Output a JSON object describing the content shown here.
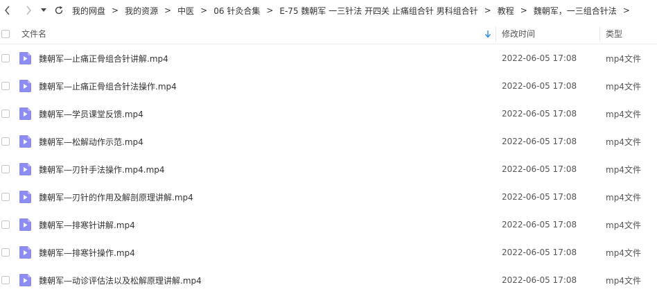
{
  "breadcrumb": {
    "separator": ">",
    "items": [
      "我的网盘",
      "我的资源",
      "中医",
      "06 针灸合集",
      "E-75 魏朝军 一三针法 开四关 止痛组合针 男科组合针",
      "教程",
      "魏朝军，一三组合针法"
    ],
    "trailing_separator": ">"
  },
  "header": {
    "name_label": "文件名",
    "modified_label": "修改时间",
    "type_label": "类型"
  },
  "icons": {
    "back": "chevron-left-icon",
    "forward": "chevron-right-icon",
    "dropdown": "caret-down-icon",
    "refresh": "refresh-icon",
    "sort": "sort-down-icon",
    "file": "video-file-icon"
  },
  "colors": {
    "sort_arrow": "#2b8ce8",
    "file_icon": "#8c8cf3"
  },
  "files": [
    {
      "name": "魏朝军—止痛正骨组合针讲解.mp4",
      "modified": "2022-06-05 17:08",
      "type": "mp4文件"
    },
    {
      "name": "魏朝军—止痛正骨组合针法操作.mp4",
      "modified": "2022-06-05 17:08",
      "type": "mp4文件"
    },
    {
      "name": "魏朝军—学员课堂反馈.mp4",
      "modified": "2022-06-05 17:08",
      "type": "mp4文件"
    },
    {
      "name": "魏朝军—松解动作示范.mp4",
      "modified": "2022-06-05 17:08",
      "type": "mp4文件"
    },
    {
      "name": "魏朝军—刃针手法操作.mp4.mp4",
      "modified": "2022-06-05 17:08",
      "type": "mp4文件"
    },
    {
      "name": "魏朝军—刃针的作用及解剖原理讲解.mp4",
      "modified": "2022-06-05 17:08",
      "type": "mp4文件"
    },
    {
      "name": "魏朝军—排寒针讲解.mp4",
      "modified": "2022-06-05 17:08",
      "type": "mp4文件"
    },
    {
      "name": "魏朝军—排寒针操作.mp4",
      "modified": "2022-06-05 17:08",
      "type": "mp4文件"
    },
    {
      "name": "魏朝军—动诊评估法以及松解原理讲解.mp4",
      "modified": "2022-06-05 17:08",
      "type": "mp4文件"
    }
  ]
}
